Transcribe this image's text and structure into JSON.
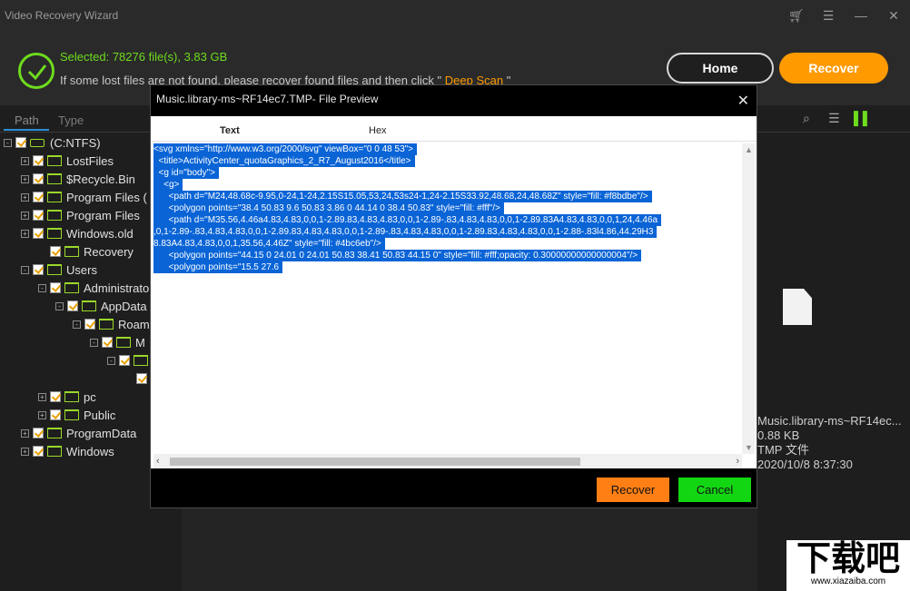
{
  "app": {
    "title": "Video Recovery Wizard"
  },
  "header": {
    "selected_text": "Selected: 78276 file(s), 3.83 GB",
    "hint_prefix": "If some lost files are not found, please recover found files and then click \"",
    "deep_scan_label": "Deep Scan",
    "hint_suffix": "\"",
    "home_label": "Home",
    "recover_label": "Recover"
  },
  "sidebar": {
    "tabs": [
      "Path",
      "Type"
    ],
    "tree": [
      {
        "label": "(C:NTFS)",
        "level": 0,
        "type": "drive",
        "expander": "-"
      },
      {
        "label": "LostFiles",
        "level": 1,
        "type": "folder",
        "expander": "+"
      },
      {
        "label": "$Recycle.Bin",
        "level": 1,
        "type": "folder",
        "expander": "+"
      },
      {
        "label": "Program Files (",
        "level": 1,
        "type": "folder",
        "expander": "+"
      },
      {
        "label": "Program Files",
        "level": 1,
        "type": "folder",
        "expander": "+"
      },
      {
        "label": "Windows.old",
        "level": 1,
        "type": "folder",
        "expander": "+"
      },
      {
        "label": "Recovery",
        "level": 2,
        "type": "folder",
        "expander": ""
      },
      {
        "label": "Users",
        "level": 1,
        "type": "folder",
        "expander": "-"
      },
      {
        "label": "Administrato",
        "level": 2,
        "type": "folder",
        "expander": "-"
      },
      {
        "label": "AppData",
        "level": 3,
        "type": "folder",
        "expander": "-"
      },
      {
        "label": "Roam",
        "level": 4,
        "type": "folder",
        "expander": "-"
      },
      {
        "label": "M",
        "level": 5,
        "type": "folder",
        "expander": "-"
      },
      {
        "label": "",
        "level": 6,
        "type": "folder",
        "expander": "-"
      },
      {
        "label": "",
        "level": 7,
        "type": "check",
        "expander": ""
      },
      {
        "label": "pc",
        "level": 2,
        "type": "folder",
        "expander": "+"
      },
      {
        "label": "Public",
        "level": 2,
        "type": "folder",
        "expander": "+"
      },
      {
        "label": "ProgramData",
        "level": 1,
        "type": "folder",
        "expander": "+"
      },
      {
        "label": "Windows",
        "level": 1,
        "type": "folder",
        "expander": "+"
      }
    ]
  },
  "dialog": {
    "title": "Music.library-ms~RF14ec7.TMP- File Preview",
    "tabs": [
      "Text",
      "Hex"
    ],
    "lines": [
      "<svg xmlns=\"http://www.w3.org/2000/svg\" viewBox=\"0 0 48 53\">",
      "  <title>ActivityCenter_quotaGraphics_2_R7_August2016</title>",
      "  <g id=\"body\">",
      "    <g>",
      "      <path d=\"M24,48.68c-9.95,0-24,1-24,2.15S15.05,53,24,53s24-1,24-2.15S33.92,48.68,24,48.68Z\" style=\"fill: #f8bdbe\"/>",
      "      <polygon points=\"38.4 50.83 9.6 50.83 3.86 0 44.14 0 38.4 50.83\" style=\"fill: #fff\"/>",
      "      <path d=\"M35.56,4.46a4.83,4.83,0,0,1-2.89.83,4.83,4.83,0,0,1-2.89-.83,4.83,4.83,0,0,1-2.89.83A4.83,4.83,0,0,1,24,4.46a",
      ",0,1-2.89-.83,4.83,4.83,0,0,1-2.89.83,4.83,4.83,0,0,1-2.89-.83,4.83,4.83,0,0,1-2.89.83,4.83,4.83,0,0,1-2.88-.83l4.86,44.29H3",
      "8.83A4.83,4.83,0,0,1,35.56,4.46Z\" style=\"fill: #4bc6eb\"/>",
      "      <polygon points=\"44.15 0 24.01 0 24.01 50.83 38.41 50.83 44.15 0\" style=\"fill: #fff;opacity: 0.30000000000000004\"/>",
      "      <polygon points=\"15.5 27.6"
    ],
    "recover_label": "Recover",
    "cancel_label": "Cancel"
  },
  "preview": {
    "file_name": "Music.library-ms~RF14ec...",
    "file_size": "0.88 KB",
    "file_type": "TMP 文件",
    "file_date": "2020/10/8 8:37:30"
  },
  "watermark": {
    "cn_text": "下载吧",
    "url": "www.xiazaiba.com"
  },
  "colors": {
    "accent_green": "#6ddc1d",
    "accent_orange": "#ff9a00",
    "selection_blue": "#0a64d6"
  }
}
